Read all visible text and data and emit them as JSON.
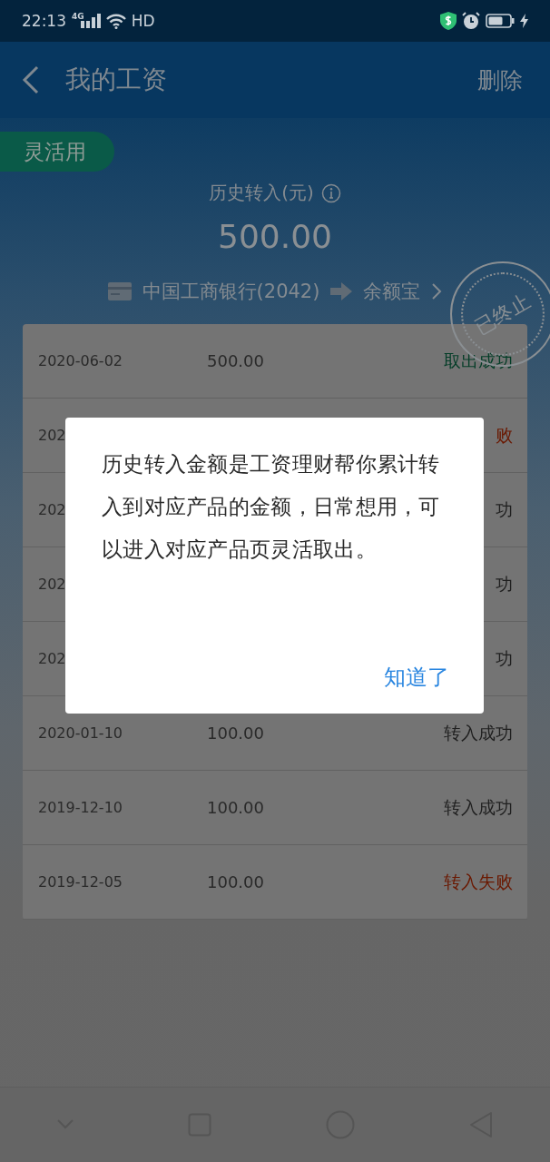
{
  "status_bar": {
    "time": "22:13",
    "network": "4G",
    "hd": "HD"
  },
  "header": {
    "title": "我的工资",
    "action": "删除"
  },
  "tag": "灵活用",
  "summary": {
    "label": "历史转入(元)",
    "amount": "500.00",
    "from": "中国工商银行(2042)",
    "to": "余额宝",
    "stamp": "已终止"
  },
  "records": [
    {
      "date": "2020-06-02",
      "amount": "500.00",
      "status": "取出成功",
      "color": "#033d27"
    },
    {
      "date": "202",
      "status": "败",
      "color": "#6a1800"
    },
    {
      "date": "202",
      "status": "功",
      "color": "#1f1f1f"
    },
    {
      "date": "202",
      "status": "功",
      "color": "#1f1f1f"
    },
    {
      "date": "202",
      "status": "功",
      "color": "#1f1f1f"
    },
    {
      "date": "2020-01-10",
      "amount": "100.00",
      "status": "转入成功",
      "color": "#1f1f1f"
    },
    {
      "date": "2019-12-10",
      "amount": "100.00",
      "status": "转入成功",
      "color": "#1f1f1f"
    },
    {
      "date": "2019-12-05",
      "amount": "100.00",
      "status": "转入失败",
      "color": "#6a1800"
    }
  ],
  "dialog": {
    "message": "历史转入金额是工资理财帮你累计转入到对应产品的金额，日常想用，可以进入对应产品页灵活取出。",
    "button": "知道了"
  }
}
